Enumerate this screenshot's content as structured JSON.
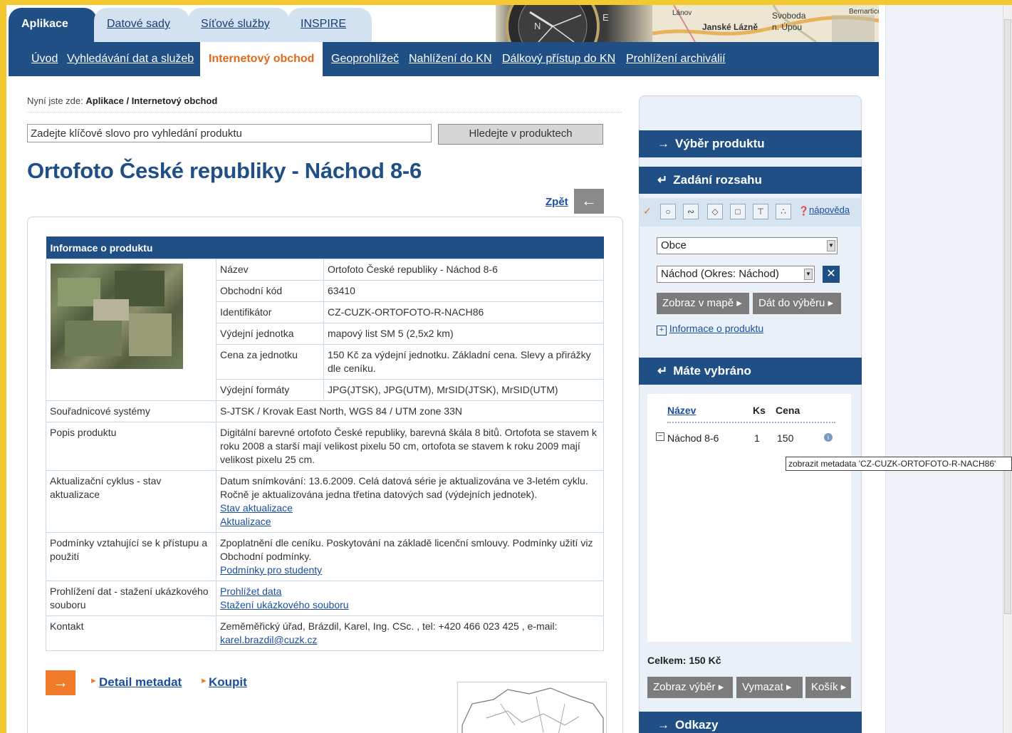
{
  "tabs": [
    {
      "label": "Aplikace",
      "active": true
    },
    {
      "label": "Datové sady",
      "active": false
    },
    {
      "label": "Síťové služby",
      "active": false
    },
    {
      "label": "INSPIRE",
      "active": false
    }
  ],
  "map_header": {
    "labels": [
      "Lánov",
      "Svoboda",
      "Janské Lázně",
      "n. Úpou",
      "Bernartice"
    ]
  },
  "nav": [
    {
      "label": "Úvod"
    },
    {
      "label": "Vyhledávání dat a služeb"
    },
    {
      "label": "Internetový obchod",
      "active": true
    },
    {
      "label": "Geoprohlížeč"
    },
    {
      "label": "Nahlížení do KN"
    },
    {
      "label": "Dálkový přístup do KN"
    },
    {
      "label": "Prohlížení archiválií"
    }
  ],
  "breadcrumb": {
    "prefix": "Nyní jste zde:",
    "path": "Aplikace / Internetový obchod"
  },
  "search": {
    "value": "Zadejte klíčové slovo pro vyhledání produktu",
    "button": "Hledejte v produktech"
  },
  "title": "Ortofoto České republiky - Náchod 8-6",
  "back": {
    "label": "Zpět"
  },
  "info": {
    "header": "Informace o produktu",
    "rows": [
      {
        "label": "Název",
        "value": "Ortofoto České republiky - Náchod 8-6"
      },
      {
        "label": "Obchodní kód",
        "value": "63410"
      },
      {
        "label": "Identifikátor",
        "value": "CZ-CUZK-ORTOFOTO-R-NACH86"
      },
      {
        "label": "Výdejní jednotka",
        "value": "mapový list SM 5 (2,5x2 km)"
      },
      {
        "label": "Cena za jednotku",
        "value": "150 Kč za výdejní jednotku. Základní cena. Slevy a přirážky dle ceníku."
      },
      {
        "label": "Výdejní formáty",
        "value": "JPG(JTSK), JPG(UTM), MrSID(JTSK), MrSID(UTM)"
      }
    ],
    "coords_label": "Souřadnicové systémy",
    "coords_value": "S-JTSK / Krovak East North, WGS 84 / UTM zone 33N",
    "desc_label": "Popis produktu",
    "desc_value": "Digitální barevné ortofoto České republiky, barevná škála 8 bitů. Ortofota se stavem k roku 2008 a starší mají velikost pixelu 50 cm, ortofota se stavem k roku 2009 mají velikost pixelu 25 cm.",
    "update_label": "Aktualizační cyklus - stav aktualizace",
    "update_value": "Datum snímkování: 13.6.2009. Celá datová série je aktualizována ve 3-letém cyklu. Ročně je aktualizována jedna třetina datových sad (výdejních jednotek).",
    "update_link1": "Stav aktualizace",
    "update_link2": "Aktualizace",
    "terms_label": "Podmínky vztahující se k přístupu a použití",
    "terms_value": "Zpoplatnění dle ceníku. Poskytování na základě licenční smlouvy. Podmínky užití viz Obchodní podmínky.",
    "terms_link": "Podmínky pro studenty",
    "preview_label": "Prohlížení dat - stažení ukázkového souboru",
    "preview_link1": "Prohlížet data",
    "preview_link2": "Stažení ukázkového souboru",
    "contact_label": "Kontakt",
    "contact_value": "Zeměměřický úřad, Brázdil, Karel, Ing. CSc. , tel: +420 466 023 425 , e-mail:",
    "contact_email": "karel.brazdil@cuzk.cz"
  },
  "bottom": {
    "detail": "Detail metadat",
    "buy": "Koupit"
  },
  "sidebar": {
    "select_product": "Výběr produktu",
    "range": "Zadání rozsahu",
    "help": "nápověda",
    "type_select": "Obce",
    "place_select": "Náchod (Okres: Náchod)",
    "show_map": "Zobraz v mapě",
    "add_selection": "Dát do výběru",
    "product_info": "Informace o produktu",
    "selected": "Máte vybráno",
    "col_name": "Název",
    "col_qty": "Ks",
    "col_price": "Cena",
    "item_name": "Náchod 8-6",
    "item_qty": "1",
    "item_price": "150",
    "tooltip": "zobrazit metadata 'CZ-CUZK-ORTOFOTO-R-NACH86'",
    "total": "Celkem: 150 Kč",
    "show_selection": "Zobraz výběr",
    "delete": "Vymazat",
    "cart": "Košík",
    "links": "Odkazy"
  },
  "colors": {
    "brand": "#1f4f84",
    "accent": "#f07b2a",
    "link": "#1a4fa0"
  }
}
